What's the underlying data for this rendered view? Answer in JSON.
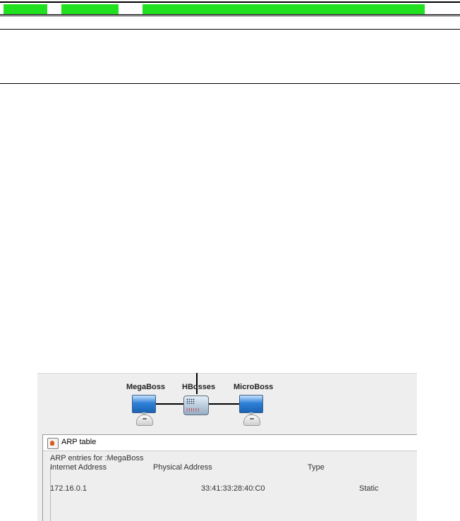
{
  "embedded": {
    "devices": {
      "megaboss": "MegaBoss",
      "hbosses": "HBosses",
      "microboss": "MicroBoss"
    },
    "switch_ports": "!!!!!!"
  },
  "arp_window": {
    "title": "ARP table",
    "heading": "ARP entries for :MegaBoss",
    "columns": [
      "Internet Address",
      "Physical Address",
      "Type"
    ],
    "rows": [
      {
        "internet_address": "172.16.0.1",
        "physical_address": "33:41:33:28:40:C0",
        "type": "Static"
      }
    ]
  },
  "colors": {
    "progress_green": "#20e020",
    "monitor_blue": "#2f80d8",
    "port_red": "#d01010"
  }
}
